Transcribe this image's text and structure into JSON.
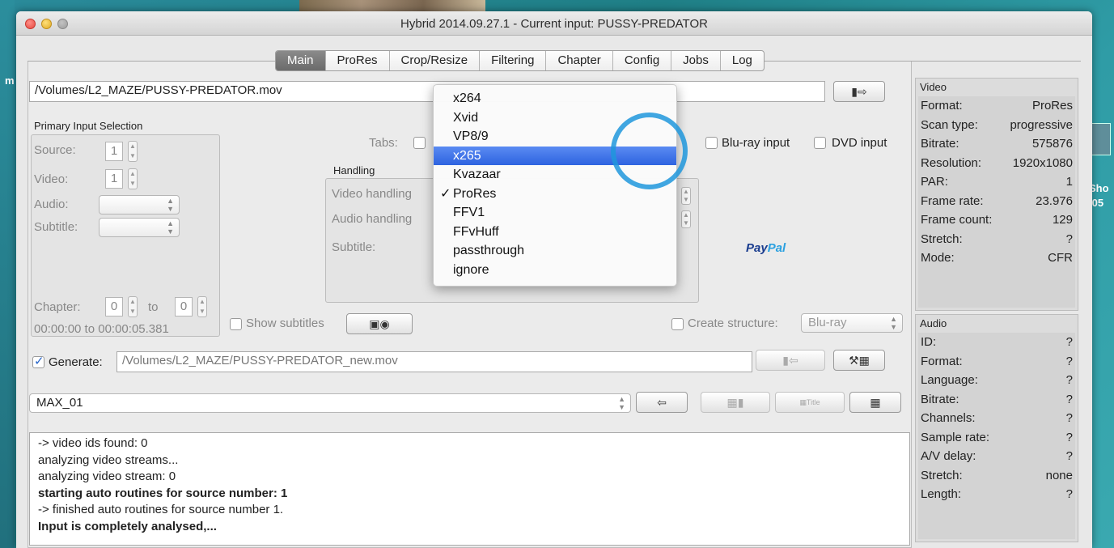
{
  "window": {
    "title": "Hybrid 2014.09.27.1 - Current input: PUSSY-PREDATOR"
  },
  "desktop": {
    "left_label": "m",
    "right_label_1": "Sho",
    "right_label_2": ".05"
  },
  "tabs": [
    "Main",
    "ProRes",
    "Crop/Resize",
    "Filtering",
    "Chapter",
    "Config",
    "Jobs",
    "Log"
  ],
  "active_tab": "Main",
  "input": {
    "path": "/Volumes/L2_MAZE/PUSSY-PREDATOR.mov"
  },
  "primary_input": {
    "title": "Primary Input Selection",
    "source_label": "Source:",
    "source_value": "1",
    "video_label": "Video:",
    "video_value": "1",
    "audio_label": "Audio:",
    "subtitle_label": "Subtitle:",
    "chapter_label": "Chapter:",
    "chapter_from": "0",
    "chapter_to_label": "to",
    "chapter_to": "0",
    "time_range": "00:00:00 to 00:00:05.381"
  },
  "tabs_label": "Tabs:",
  "bluray_input": "Blu-ray input",
  "dvd_input": "DVD input",
  "handling": {
    "title": "Handling",
    "video_label": "Video handling",
    "audio_label": "Audio handling",
    "subtitle_label": "Subtitle:"
  },
  "paypal": {
    "part1": "Pay",
    "part2": "Pal"
  },
  "show_subtitles": "Show subtitles",
  "create_structure": {
    "label": "Create structure:",
    "value": "Blu-ray"
  },
  "generate": {
    "label": "Generate:",
    "path": "/Volumes/L2_MAZE/PUSSY-PREDATOR_new.mov",
    "checked": true
  },
  "preset": {
    "value": "MAX_01",
    "title_button": "Title"
  },
  "dropdown": {
    "items": [
      "x264",
      "Xvid",
      "VP8/9",
      "x265",
      "Kvazaar",
      "ProRes",
      "FFV1",
      "FFvHuff",
      "passthrough",
      "ignore"
    ],
    "selected": "x265",
    "checked": "ProRes"
  },
  "video_info": {
    "title": "Video",
    "rows": [
      {
        "key": "Format:",
        "value": "ProRes"
      },
      {
        "key": "Scan type:",
        "value": "progressive"
      },
      {
        "key": "Bitrate:",
        "value": "575876"
      },
      {
        "key": "Resolution:",
        "value": "1920x1080"
      },
      {
        "key": "PAR:",
        "value": "1"
      },
      {
        "key": "Frame rate:",
        "value": "23.976"
      },
      {
        "key": "Frame count:",
        "value": "129"
      },
      {
        "key": "Stretch:",
        "value": "?"
      },
      {
        "key": "Mode:",
        "value": "CFR"
      }
    ]
  },
  "audio_info": {
    "title": "Audio",
    "rows": [
      {
        "key": "ID:",
        "value": "?"
      },
      {
        "key": "Format:",
        "value": "?"
      },
      {
        "key": "Language:",
        "value": "?"
      },
      {
        "key": "Bitrate:",
        "value": "?"
      },
      {
        "key": "Channels:",
        "value": "?"
      },
      {
        "key": "Sample rate:",
        "value": "?"
      },
      {
        "key": "A/V delay:",
        "value": "?"
      },
      {
        "key": "Stretch:",
        "value": "none"
      },
      {
        "key": "Length:",
        "value": "?"
      }
    ]
  },
  "log": [
    {
      "text": " -> video ids found: 0",
      "bold": false
    },
    {
      "text": "analyzing video streams...",
      "bold": false
    },
    {
      "text": " analyzing video stream: 0",
      "bold": false
    },
    {
      "text": "starting auto routines for source number: 1",
      "bold": true
    },
    {
      "text": " -> finished auto routines for source number 1.",
      "bold": false
    },
    {
      "text": "Input is completely analysed,...",
      "bold": true
    }
  ]
}
